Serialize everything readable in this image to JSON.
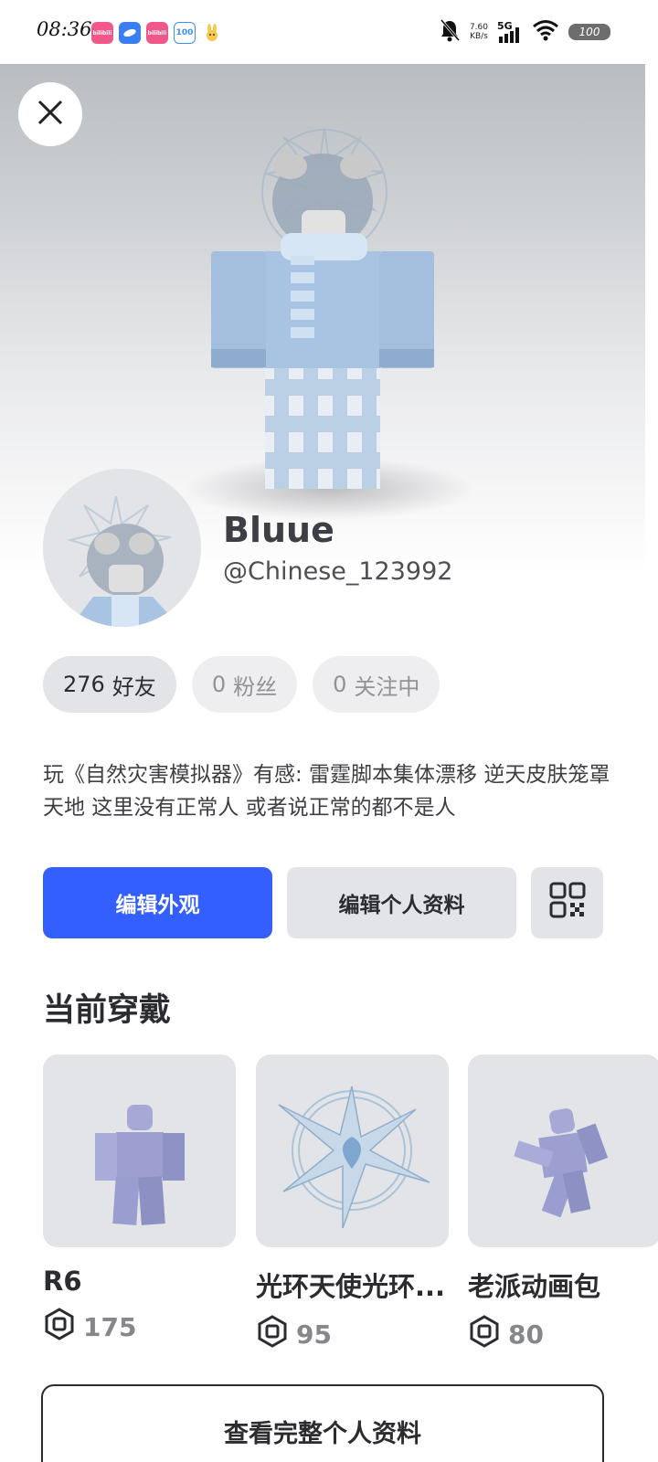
{
  "status_bar": {
    "time": "08:36",
    "network_speed_value": "7.60",
    "network_speed_unit": "KB/s",
    "network_type": "5G",
    "battery": "100",
    "app_icons": [
      {
        "name": "bilibili-icon",
        "label": "bilibili",
        "color": "#f2578a"
      },
      {
        "name": "blue-app-icon",
        "label": "",
        "color": "#3a7ef3"
      },
      {
        "name": "bilibili-icon-2",
        "label": "bilibili",
        "color": "#f2578a"
      },
      {
        "name": "app-100-icon",
        "label": "100",
        "color": "#3b8ef6"
      },
      {
        "name": "rabbit-app-icon",
        "label": "",
        "color": "#f7c84a"
      }
    ]
  },
  "profile": {
    "display_name": "Bluue",
    "username": "@Chinese_123992",
    "stats": [
      {
        "value": "276",
        "label": "好友"
      },
      {
        "value": "0",
        "label": "粉丝"
      },
      {
        "value": "0",
        "label": "关注中"
      }
    ],
    "bio": "玩《自然灾害模拟器》有感: 雷霆脚本集体漂移 逆天皮肤笼罩天地 这里没有正常人 或者说正常的都不是人"
  },
  "actions": {
    "edit_avatar": "编辑外观",
    "edit_profile": "编辑个人资料",
    "qr_icon": "qr-code-icon"
  },
  "wearing": {
    "title": "当前穿戴",
    "items": [
      {
        "name": "R6",
        "price": "175"
      },
      {
        "name": "光环天使光环...",
        "price": "95"
      },
      {
        "name": "老派动画包",
        "price": "80"
      }
    ]
  },
  "footer": {
    "view_full_profile": "查看完整个人资料"
  },
  "colors": {
    "accent": "#335fff",
    "chip_bg": "#e3e4e8",
    "text_dark": "#2a2c30"
  }
}
